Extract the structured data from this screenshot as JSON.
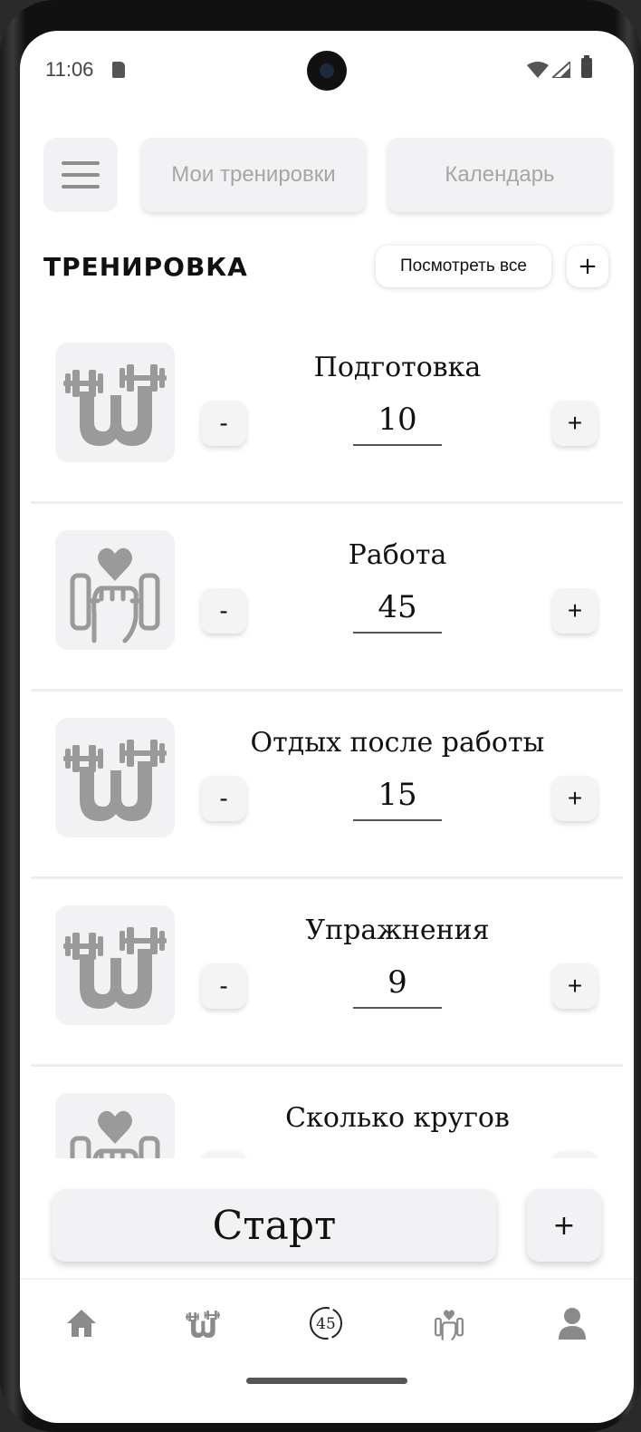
{
  "status_bar": {
    "time": "11:06",
    "icons": [
      "sd-card-icon",
      "wifi-icon",
      "signal-icon",
      "battery-icon"
    ]
  },
  "top_nav": {
    "menu_icon": "hamburger-menu-icon",
    "my_trainings_label": "Мои тренировки",
    "calendar_label": "Календарь"
  },
  "section": {
    "title": "ТРЕНИРОВКА",
    "view_all_label": "Посмотреть все",
    "add_label": "+"
  },
  "items": [
    {
      "title": "Подготовка",
      "value": "10",
      "icon": "dumbbell-logo-icon",
      "minus_label": "-",
      "plus_label": "+"
    },
    {
      "title": "Работа",
      "value": "45",
      "icon": "fitness-heart-hand-icon",
      "minus_label": "-",
      "plus_label": "+"
    },
    {
      "title": "Отдых после работы",
      "value": "15",
      "icon": "dumbbell-logo-icon",
      "minus_label": "-",
      "plus_label": "+"
    },
    {
      "title": "Упражнения",
      "value": "9",
      "icon": "dumbbell-logo-icon",
      "minus_label": "-",
      "plus_label": "+"
    },
    {
      "title": "Сколько кругов",
      "value": "",
      "icon": "fitness-heart-hand-icon",
      "minus_label": "-",
      "plus_label": "+"
    }
  ],
  "start": {
    "label": "Старт",
    "add_label": "+"
  },
  "bottom_nav": {
    "items": [
      {
        "name": "home",
        "icon": "home-icon"
      },
      {
        "name": "workouts",
        "icon": "dumbbell-logo-icon"
      },
      {
        "name": "timer",
        "icon": "timer-icon",
        "label": "45"
      },
      {
        "name": "fitness",
        "icon": "fitness-heart-hand-icon"
      },
      {
        "name": "profile",
        "icon": "user-icon"
      }
    ]
  },
  "colors": {
    "background": "#ffffff",
    "card": "#f2f2f4",
    "icon_gray": "#9a9a9a",
    "text": "#111111",
    "muted_text": "#a6a6a6"
  }
}
